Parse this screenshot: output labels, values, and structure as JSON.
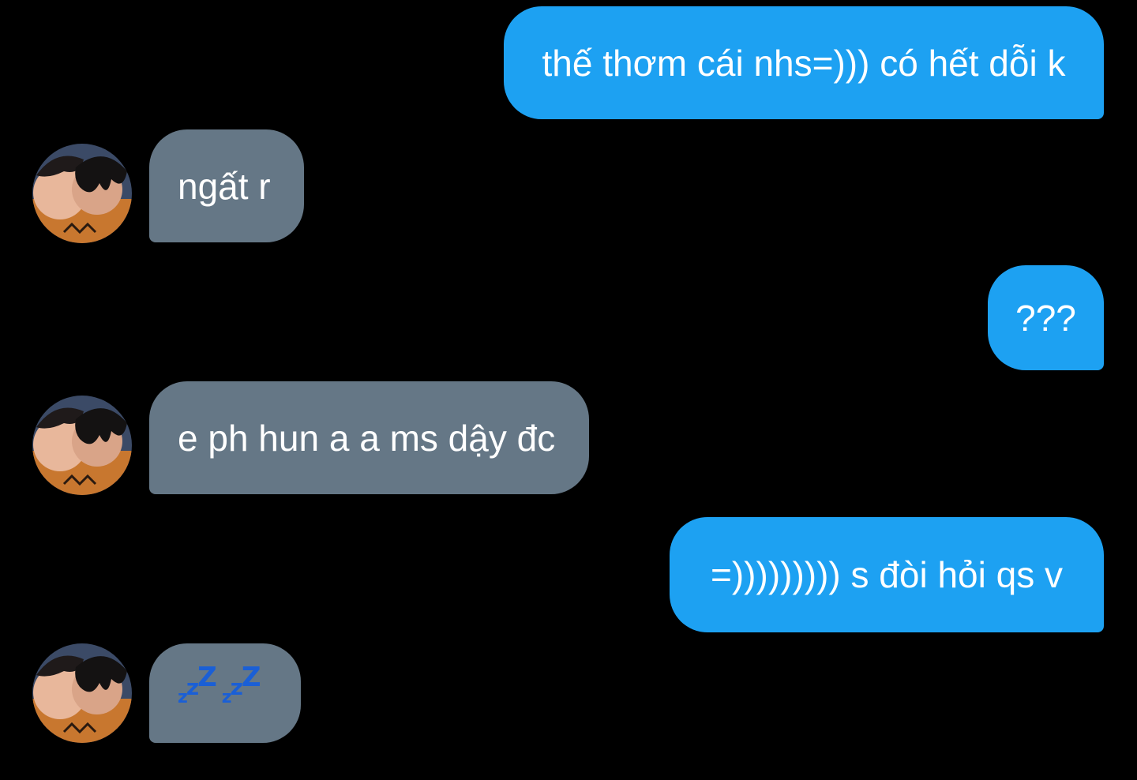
{
  "conversation": {
    "messages": [
      {
        "direction": "sent",
        "text": "thế thơm cái nhs=))) có hết dỗi k"
      },
      {
        "direction": "received",
        "text": "ngất r"
      },
      {
        "direction": "sent",
        "text": "???"
      },
      {
        "direction": "received",
        "text": "e ph hun a a ms dậy đc"
      },
      {
        "direction": "sent",
        "text": "=))))))))) s đòi hỏi qs v"
      },
      {
        "direction": "received",
        "emoji": "sleeping-zzz-icon"
      }
    ]
  },
  "colors": {
    "background": "#000000",
    "sent_bubble": "#1da1f2",
    "received_bubble": "#657786",
    "text": "#ffffff",
    "zzz": "#1a5fd6"
  }
}
